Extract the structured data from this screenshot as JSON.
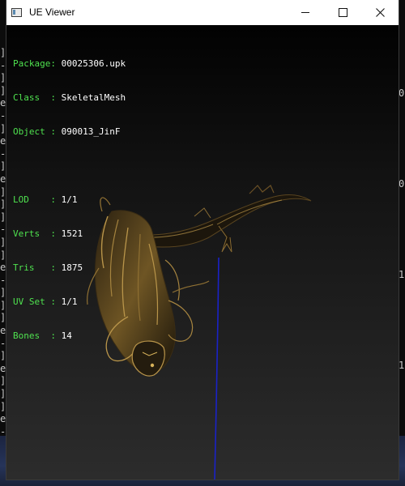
{
  "background_console": {
    "left_column": [
      "]",
      "-",
      "]",
      "]",
      "e",
      "-",
      "]",
      "e",
      "-",
      "]",
      "e",
      "]",
      "]",
      "]",
      "-",
      "]",
      "]",
      "e",
      "-",
      "]",
      "]",
      "]",
      "e",
      "-",
      "]",
      "e",
      "]",
      "]",
      "]",
      "e",
      "-",
      "]",
      "e",
      "]",
      "]",
      "]"
    ],
    "right_column": [
      "0",
      "0",
      "1",
      "1"
    ]
  },
  "window": {
    "title": "UE Viewer",
    "icon": "app-window-icon",
    "controls": {
      "minimize": "minimize-icon",
      "maximize": "maximize-icon",
      "close": "close-icon"
    }
  },
  "info": {
    "rows": [
      {
        "key": "Package:",
        "value": "00025306.upk"
      },
      {
        "key": "Class  :",
        "value": "SkeletalMesh"
      },
      {
        "key": "Object :",
        "value": "090013_JinF"
      }
    ],
    "stats": [
      {
        "key": "LOD    :",
        "value": "1/1"
      },
      {
        "key": "Verts  :",
        "value": "1521"
      },
      {
        "key": "Tris   :",
        "value": "1875"
      },
      {
        "key": "UV Set :",
        "value": "1/1"
      },
      {
        "key": "Bones  :",
        "value": "14"
      }
    ]
  },
  "colors": {
    "label": "#4fe24f",
    "value": "#ffffff",
    "axis_line": "#1a22c8",
    "mesh_dark": "#1c160c",
    "mesh_highlight": "#b9954a"
  }
}
